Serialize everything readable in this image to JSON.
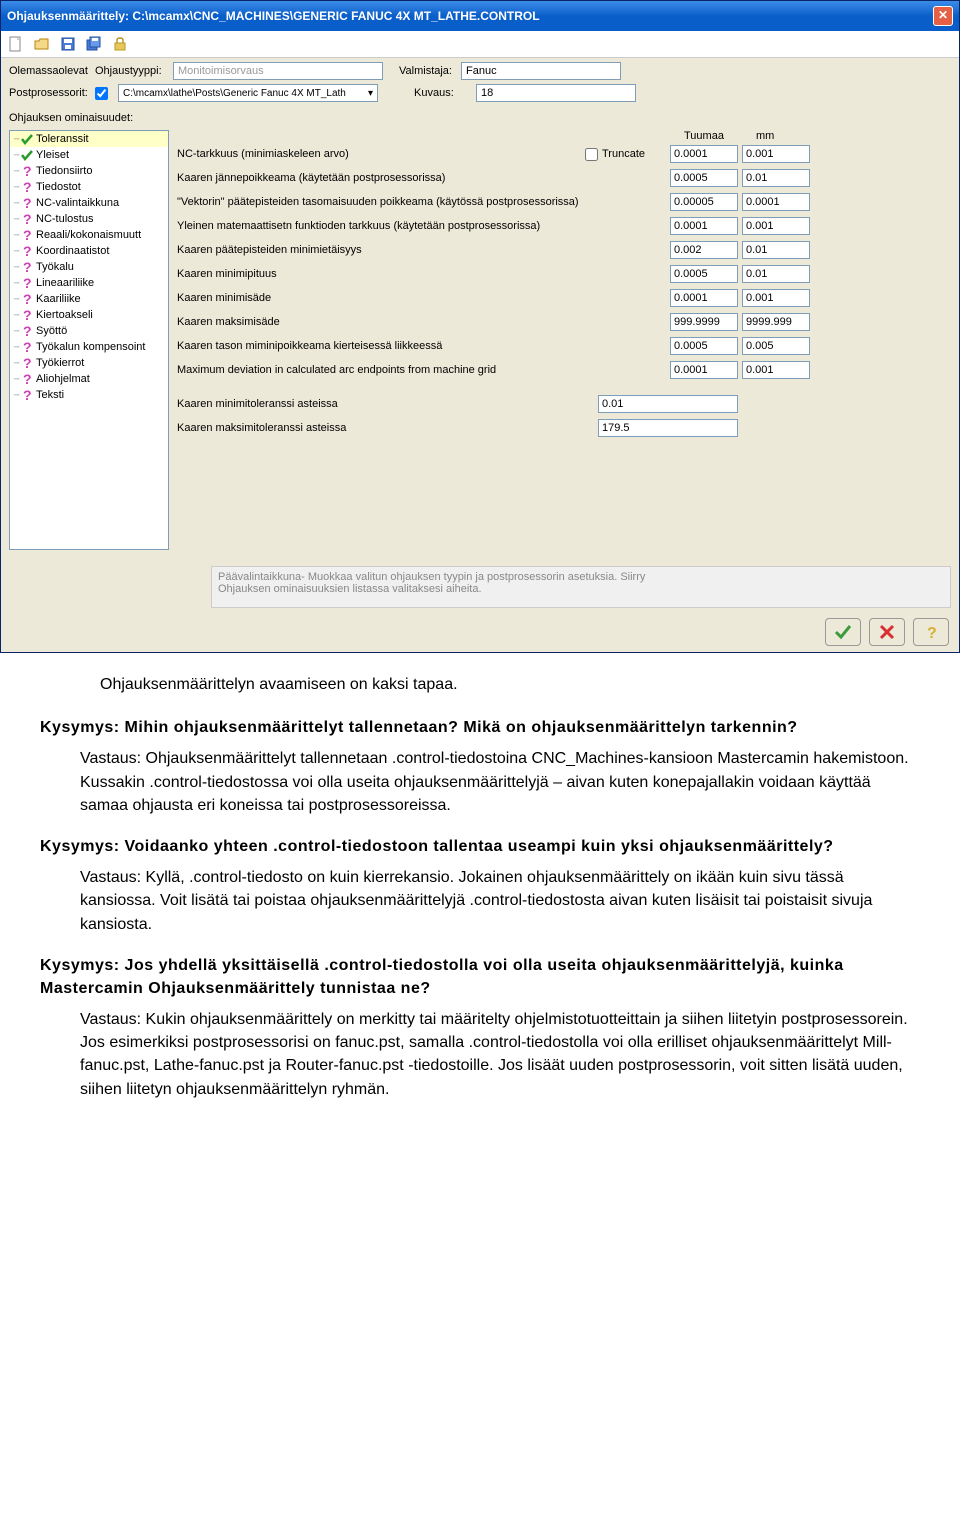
{
  "window": {
    "title": "Ohjauksenmäärittely: C:\\mcamx\\CNC_MACHINES\\GENERIC FANUC 4X MT_LATHE.CONTROL"
  },
  "header": {
    "existing_label": "Olemassaolevat",
    "type_label": "Ohjaustyyppi:",
    "type_value": "Monitoimisorvaus",
    "manufacturer_label": "Valmistaja:",
    "manufacturer_value": "Fanuc",
    "post_label": "Postprosessorit:",
    "post_value": "C:\\mcamx\\lathe\\Posts\\Generic Fanuc 4X MT_Lath",
    "description_label": "Kuvaus:",
    "description_value": "18",
    "properties_label": "Ohjauksen ominaisuudet:"
  },
  "tree": [
    {
      "label": "Toleranssit",
      "kind": "check",
      "selected": true
    },
    {
      "label": "Yleiset",
      "kind": "check"
    },
    {
      "label": "Tiedonsiirto",
      "kind": "quest"
    },
    {
      "label": "Tiedostot",
      "kind": "quest"
    },
    {
      "label": "NC-valintaikkuna",
      "kind": "quest"
    },
    {
      "label": "NC-tulostus",
      "kind": "quest"
    },
    {
      "label": "Reaali/kokonaismuutt",
      "kind": "quest"
    },
    {
      "label": "Koordinaatistot",
      "kind": "quest"
    },
    {
      "label": "Työkalu",
      "kind": "quest"
    },
    {
      "label": "Lineaariliike",
      "kind": "quest"
    },
    {
      "label": "Kaariliike",
      "kind": "quest"
    },
    {
      "label": "Kiertoakseli",
      "kind": "quest"
    },
    {
      "label": "Syöttö",
      "kind": "quest"
    },
    {
      "label": "Työkalun kompensoint",
      "kind": "quest"
    },
    {
      "label": "Työkierrot",
      "kind": "quest"
    },
    {
      "label": "Aliohjelmat",
      "kind": "quest"
    },
    {
      "label": "Teksti",
      "kind": "quest"
    }
  ],
  "columns": {
    "inch": "Tuumaa",
    "mm": "mm"
  },
  "settings": [
    {
      "label": "NC-tarkkuus (minimiaskeleen arvo)",
      "truncate": true,
      "truncate_label": "Truncate",
      "inch": "0.0001",
      "mm": "0.001"
    },
    {
      "label": "Kaaren jännepoikkeama   (käytetään postprosessorissa)",
      "inch": "0.0005",
      "mm": "0.01"
    },
    {
      "label": "\"Vektorin\" päätepisteiden tasomaisuuden poikkeama (käytössä postprosessorissa)",
      "inch": "0.00005",
      "mm": "0.0001"
    },
    {
      "label": "Yleinen matemaattisetn funktioden tarkkuus  (käytetään postprosessorissa)",
      "inch": "0.0001",
      "mm": "0.001"
    },
    {
      "label": "Kaaren päätepisteiden minimietäisyys",
      "inch": "0.002",
      "mm": "0.01"
    },
    {
      "label": "Kaaren minimipituus",
      "inch": "0.0005",
      "mm": "0.01"
    },
    {
      "label": "Kaaren minimisäde",
      "inch": "0.0001",
      "mm": "0.001"
    },
    {
      "label": "Kaaren maksimisäde",
      "inch": "999.9999",
      "mm": "9999.999"
    },
    {
      "label": "Kaaren tason miminipoikkeama kierteisessä liikkeessä",
      "inch": "0.0005",
      "mm": "0.005"
    },
    {
      "label": "Maximum deviation in calculated arc endpoints from machine grid",
      "inch": "0.0001",
      "mm": "0.001"
    }
  ],
  "angle_settings": [
    {
      "label": "Kaaren minimitoleranssi asteissa",
      "value": "0.01"
    },
    {
      "label": "Kaaren maksimitoleranssi asteissa",
      "value": "179.5"
    }
  ],
  "info_text1": "Päävalintaikkuna- Muokkaa valitun ohjauksen tyypin ja postprosessorin asetuksia. Siirry",
  "info_text2": "Ohjauksen ominaisuuksien listassa valitaksesi aiheita.",
  "doc": {
    "intro": "Ohjauksenmäärittelyn avaamiseen on kaksi tapaa.",
    "q1": "Kysymys: Mihin ohjauksenmäärittelyt tallennetaan? Mikä on ohjauksenmäärittelyn tarkennin?",
    "a1": "Vastaus: Ohjauksenmäärittelyt tallennetaan .control-tiedostoina CNC_Machines-kansioon Mastercamin hakemistoon. Kussakin .control-tiedostossa voi olla useita ohjauksenmäärittelyjä – aivan kuten konepajallakin voidaan käyttää samaa ohjausta eri koneissa tai postprosessoreissa.",
    "q2": "Kysymys: Voidaanko yhteen .control-tiedostoon tallentaa useampi kuin yksi ohjauksenmäärittely?",
    "a2": "Vastaus: Kyllä, .control-tiedosto on kuin kierrekansio. Jokainen ohjauksenmäärittely on ikään kuin sivu tässä kansiossa. Voit lisätä tai poistaa ohjauksenmäärittelyjä .control-tiedostosta aivan kuten lisäisit tai poistaisit sivuja kansiosta.",
    "q3": "Kysymys: Jos yhdellä yksittäisellä .control-tiedostolla voi olla useita ohjauksenmäärittelyjä, kuinka Mastercamin Ohjauksenmäärittely tunnistaa ne?",
    "a3": "Vastaus: Kukin ohjauksenmäärittely on merkitty tai määritelty ohjelmistotuotteittain ja siihen liitetyin postprosessorein. Jos esimerkiksi postprosessorisi on fanuc.pst, samalla .control-tiedostolla voi olla erilliset ohjauksenmäärittelyt Mill-fanuc.pst, Lathe-fanuc.pst ja Router-fanuc.pst -tiedostoille. Jos lisäät uuden postprosessorin, voit sitten lisätä uuden, siihen liitetyn ohjauksenmäärittelyn ryhmän."
  }
}
